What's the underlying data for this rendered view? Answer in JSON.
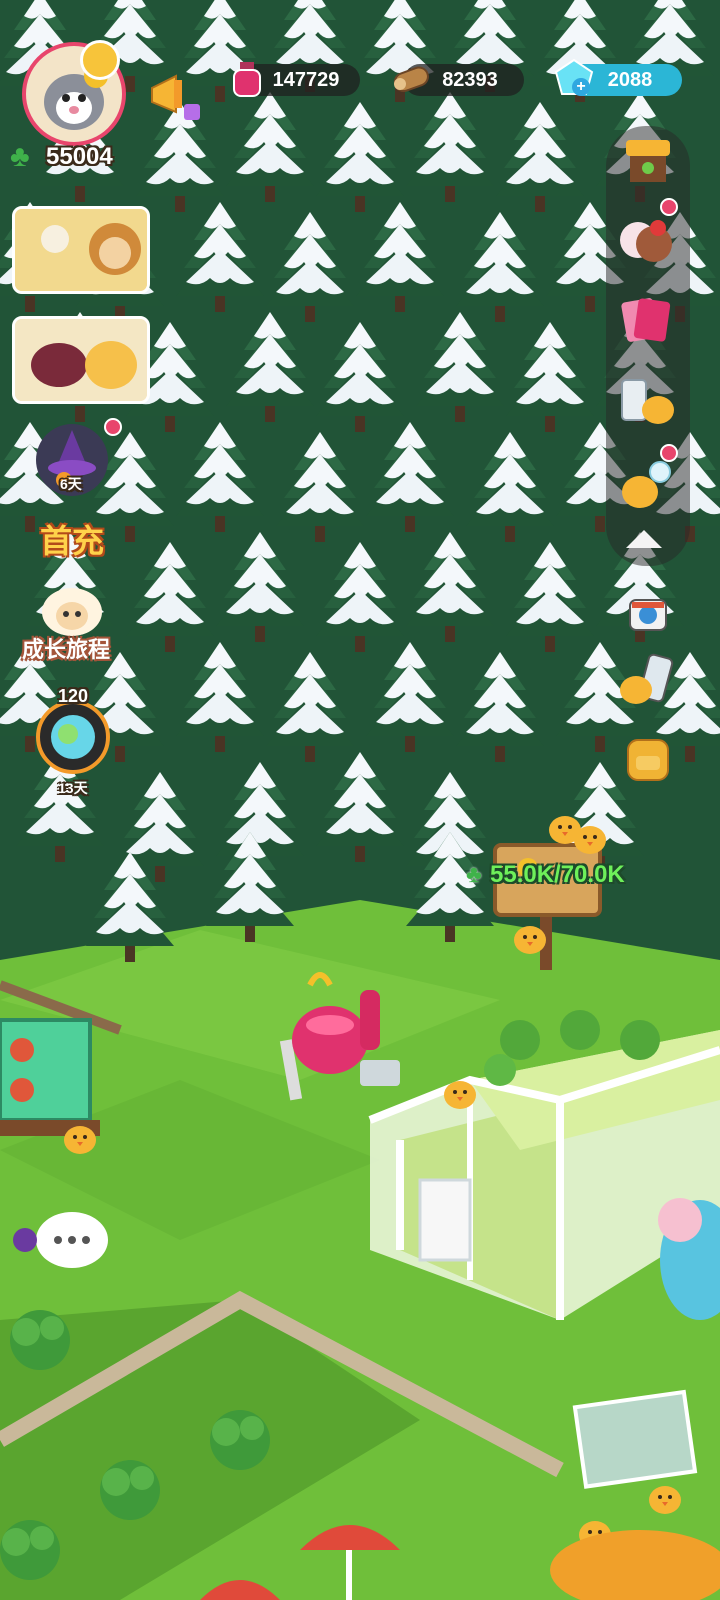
{
  "player": {
    "clover_count": "55004"
  },
  "resources": {
    "potion": "147729",
    "wood": "82393",
    "gem": "2088"
  },
  "left_menu": {
    "first_recharge_label": "首充",
    "growth_journey_label": "成长旅程",
    "event_days_label": "6天",
    "world_level": "120",
    "world_days_label": "13天"
  },
  "farm": {
    "sign_progress": "55.0K/70.0K"
  },
  "colors": {
    "grass": "#6fbf3a",
    "forest_dark": "#1f4d33",
    "snow": "#f4f8fb",
    "potion_pink": "#e0326e",
    "gem_cyan": "#3fd0e8"
  }
}
